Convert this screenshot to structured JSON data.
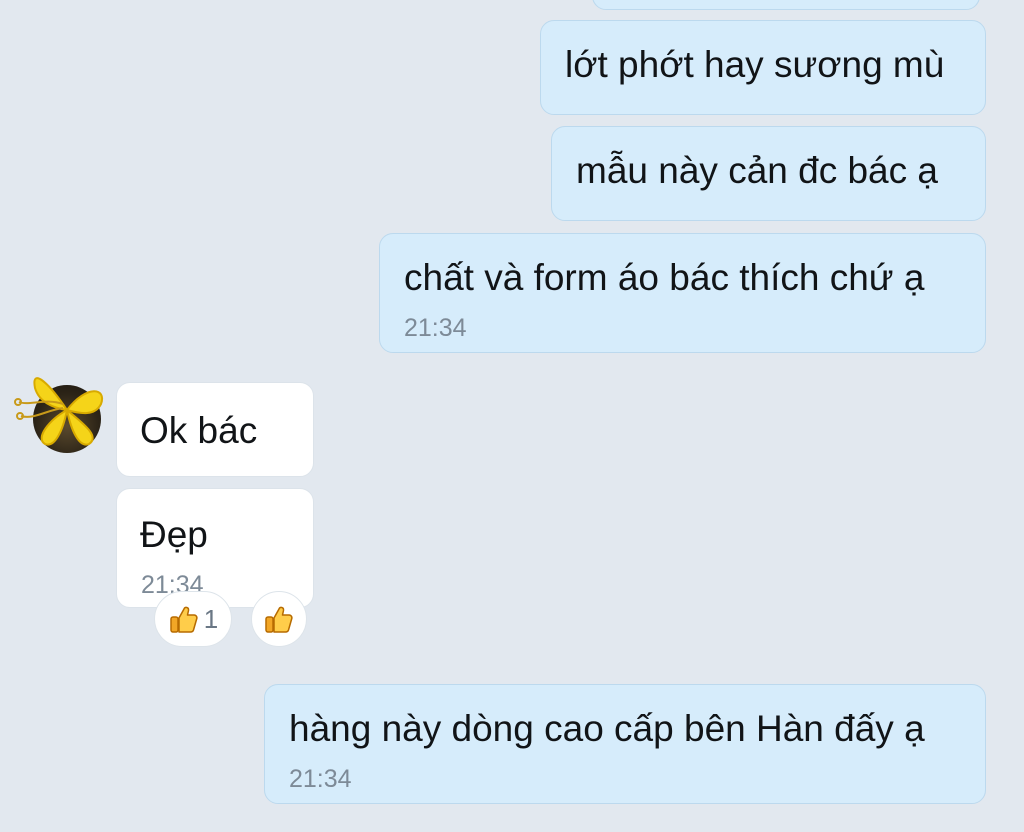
{
  "messages": [
    {
      "direction": "outgoing",
      "text": "lớt phớt hay sương mù"
    },
    {
      "direction": "outgoing",
      "text": "mẫu này cản đc bác ạ"
    },
    {
      "direction": "outgoing",
      "text": "chất và form áo bác thích chứ ạ",
      "time": "21:34"
    },
    {
      "direction": "incoming",
      "text": "Ok bác"
    },
    {
      "direction": "incoming",
      "text": "Đẹp",
      "time": "21:34"
    },
    {
      "direction": "outgoing",
      "text": "hàng này dòng cao cấp bên Hàn đấy ạ",
      "time": "21:34"
    }
  ],
  "reactions": {
    "thumbs_up_count": "1",
    "reaction_icon": "thumbs-up-icon",
    "add_reaction_icon": "thumbs-up-icon"
  },
  "colors": {
    "background": "#e2e8ef",
    "outgoing_bubble": "#d6ecfb",
    "incoming_bubble": "#ffffff",
    "time_text": "#7d8a97"
  }
}
